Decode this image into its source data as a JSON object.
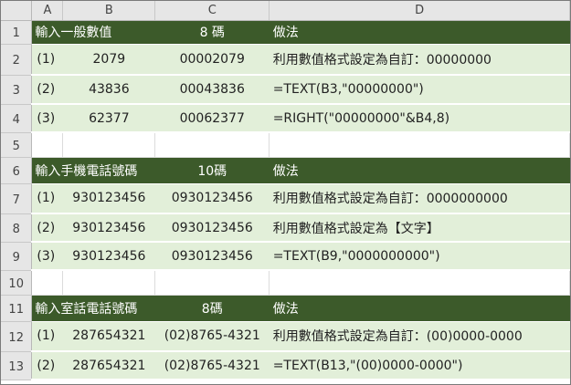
{
  "columns": [
    "A",
    "B",
    "C",
    "D"
  ],
  "rows": [
    {
      "num": "1",
      "style": "dark",
      "cells": [
        "輸入一般數值",
        "",
        "8 碼",
        "做法"
      ]
    },
    {
      "num": "2",
      "style": "light",
      "cells": [
        "(1)",
        "2079",
        "00002079",
        "利用數值格式設定為自訂：00000000"
      ]
    },
    {
      "num": "3",
      "style": "light",
      "cells": [
        "(2)",
        "43836",
        "00043836",
        "=TEXT(B3,\"00000000\")"
      ]
    },
    {
      "num": "4",
      "style": "light",
      "cells": [
        "(3)",
        "62377",
        "00062377",
        "=RIGHT(\"00000000\"&B4,8)"
      ]
    },
    {
      "num": "5",
      "style": "blank",
      "cells": [
        "",
        "",
        "",
        ""
      ]
    },
    {
      "num": "6",
      "style": "dark",
      "cells": [
        "輸入手機電話號碼",
        "",
        "10碼",
        "做法"
      ]
    },
    {
      "num": "7",
      "style": "light",
      "cells": [
        "(1)",
        "930123456",
        "0930123456",
        "利用數值格式設定為自訂：0000000000"
      ]
    },
    {
      "num": "8",
      "style": "light",
      "cells": [
        "(2)",
        "930123456",
        "0930123456",
        "利用數值格式設定為【文字】"
      ]
    },
    {
      "num": "9",
      "style": "light",
      "cells": [
        "(3)",
        "930123456",
        "0930123456",
        "=TEXT(B9,\"0000000000\")"
      ]
    },
    {
      "num": "10",
      "style": "blank",
      "cells": [
        "",
        "",
        "",
        ""
      ]
    },
    {
      "num": "11",
      "style": "dark",
      "cells": [
        "輸入室話電話號碼",
        "",
        "8碼",
        "做法"
      ]
    },
    {
      "num": "12",
      "style": "light",
      "cells": [
        "(1)",
        "287654321",
        "(02)8765-4321",
        "利用數值格式設定為自訂：(00)0000-0000"
      ]
    },
    {
      "num": "13",
      "style": "light",
      "cells": [
        "(2)",
        "287654321",
        "(02)8765-4321",
        "=TEXT(B13,\"(00)0000-0000\")"
      ]
    }
  ],
  "colors": {
    "header_dark": "#3c5a2a",
    "row_light": "#e2efd9",
    "sheet_header": "#e6e6e6"
  }
}
